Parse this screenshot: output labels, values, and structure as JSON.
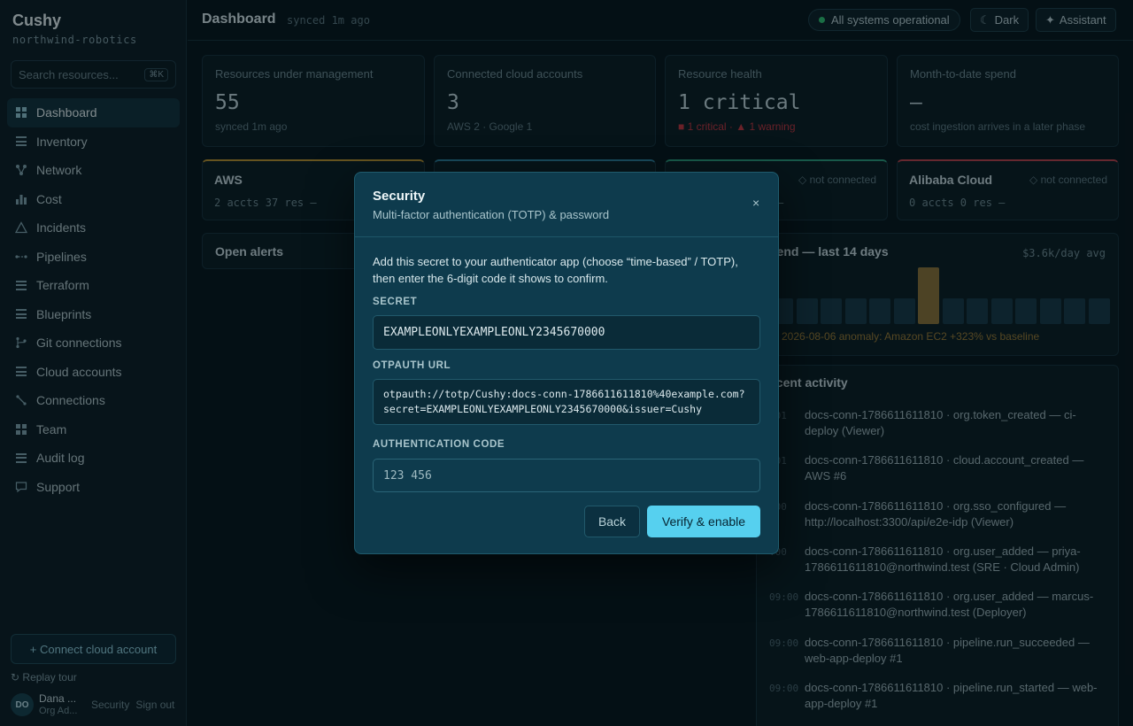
{
  "sidebar": {
    "brand": "Cushy",
    "org": "northwind-robotics",
    "search_placeholder": "Search resources...",
    "search_kbd": "⌘K",
    "nav": [
      {
        "label": "Dashboard",
        "icon": "grid-icon"
      },
      {
        "label": "Inventory",
        "icon": "list-icon"
      },
      {
        "label": "Network",
        "icon": "network-icon"
      },
      {
        "label": "Cost",
        "icon": "bar-chart-icon"
      },
      {
        "label": "Incidents",
        "icon": "warning-triangle-icon"
      },
      {
        "label": "Pipelines",
        "icon": "pipeline-icon"
      },
      {
        "label": "Terraform",
        "icon": "list-icon"
      },
      {
        "label": "Blueprints",
        "icon": "list-icon"
      },
      {
        "label": "Git connections",
        "icon": "git-branch-icon"
      },
      {
        "label": "Cloud accounts",
        "icon": "list-icon"
      },
      {
        "label": "Connections",
        "icon": "link-icon"
      },
      {
        "label": "Team",
        "icon": "grid-icon"
      },
      {
        "label": "Audit log",
        "icon": "list-icon"
      },
      {
        "label": "Support",
        "icon": "chat-bubble-icon"
      }
    ],
    "connect_label": "+ Connect cloud account",
    "replay_label": "Replay tour",
    "user": {
      "initials": "DO",
      "name": "Dana ...",
      "role": "Org Ad...",
      "security_label": "Security",
      "signout_label": "Sign out"
    }
  },
  "topbar": {
    "title": "Dashboard",
    "synced": "synced 1m ago",
    "status": "All systems operational",
    "dark_label": "Dark",
    "assistant_label": "Assistant",
    "status_color": "#2fbf71"
  },
  "stats": [
    {
      "label": "Resources under management",
      "value": "55",
      "sub": "synced 1m ago"
    },
    {
      "label": "Connected cloud accounts",
      "value": "3",
      "sub": "AWS 2 · Google 1"
    },
    {
      "label": "Resource health",
      "value": "1 critical",
      "sub": "■ 1 critical · ▲ 1 warning"
    },
    {
      "label": "Month-to-date spend",
      "value": "—",
      "sub": "cost ingestion arrives in a later phase"
    }
  ],
  "providers": [
    {
      "name": "AWS",
      "stats": "2 accts   37 res   —",
      "status": "",
      "accent": "#b8902f"
    },
    {
      "name": "",
      "stats": "",
      "status": "",
      "accent": "#2d7f9b"
    },
    {
      "name": "",
      "stats": "—",
      "status": "not connected",
      "accent": "#2b9a7a"
    },
    {
      "name": "Alibaba Cloud",
      "stats": "0 accts   0 res   —",
      "status": "not connected",
      "accent": "#b8404a"
    }
  ],
  "alerts": {
    "title": "Open alerts"
  },
  "spend": {
    "title": "pend — last 14 days",
    "avg": "$3.6k/day avg",
    "anomaly": "2026-08-06 anomaly: Amazon EC2 +323% vs baseline",
    "bar_values": [
      1,
      1,
      1,
      1,
      1,
      1,
      2.2,
      1,
      1,
      1,
      1,
      1,
      1,
      1
    ],
    "highlight_index": 6,
    "bar_color": "#173845",
    "highlight_color": "#8a7237"
  },
  "activity": {
    "title": "ecent activity",
    "items": [
      {
        "time": ":01",
        "text": "docs-conn-1786611611810 · org.token_created — ci-deploy (Viewer)"
      },
      {
        "time": ":01",
        "text": "docs-conn-1786611611810 · cloud.account_created — AWS #6"
      },
      {
        "time": ":00",
        "text": "docs-conn-1786611611810 · org.sso_configured — http://localhost:3300/api/e2e-idp (Viewer)"
      },
      {
        "time": ":00",
        "text": "docs-conn-1786611611810 · org.user_added — priya-1786611611810@northwind.test (SRE · Cloud Admin)"
      },
      {
        "time": "09:00",
        "text": "docs-conn-1786611611810 · org.user_added — marcus-1786611611810@northwind.test (Deployer)"
      },
      {
        "time": "09:00",
        "text": "docs-conn-1786611611810 · pipeline.run_succeeded — web-app-deploy #1"
      },
      {
        "time": "09:00",
        "text": "docs-conn-1786611611810 · pipeline.run_started — web-app-deploy #1"
      }
    ]
  },
  "modal": {
    "title": "Security",
    "subtitle": "Multi-factor authentication (TOTP) & password",
    "close": "×",
    "description": "Add this secret to your authenticator app (choose “time-based” / TOTP), then enter the 6-digit code it shows to confirm.",
    "secret_label": "SECRET",
    "secret": "EXAMPLEONLYEXAMPLEONLY2345670000",
    "url_label": "OTPAUTH URL",
    "url_line1": "otpauth://totp/Cushy:docs-conn-1786611611810%40example.com?",
    "url_line2": "secret=EXAMPLEONLYEXAMPLEONLY2345670000&issuer=Cushy",
    "code_label": "AUTHENTICATION CODE",
    "code_placeholder": "123 456",
    "back_label": "Back",
    "verify_label": "Verify & enable",
    "accent": "#56d0ef"
  }
}
